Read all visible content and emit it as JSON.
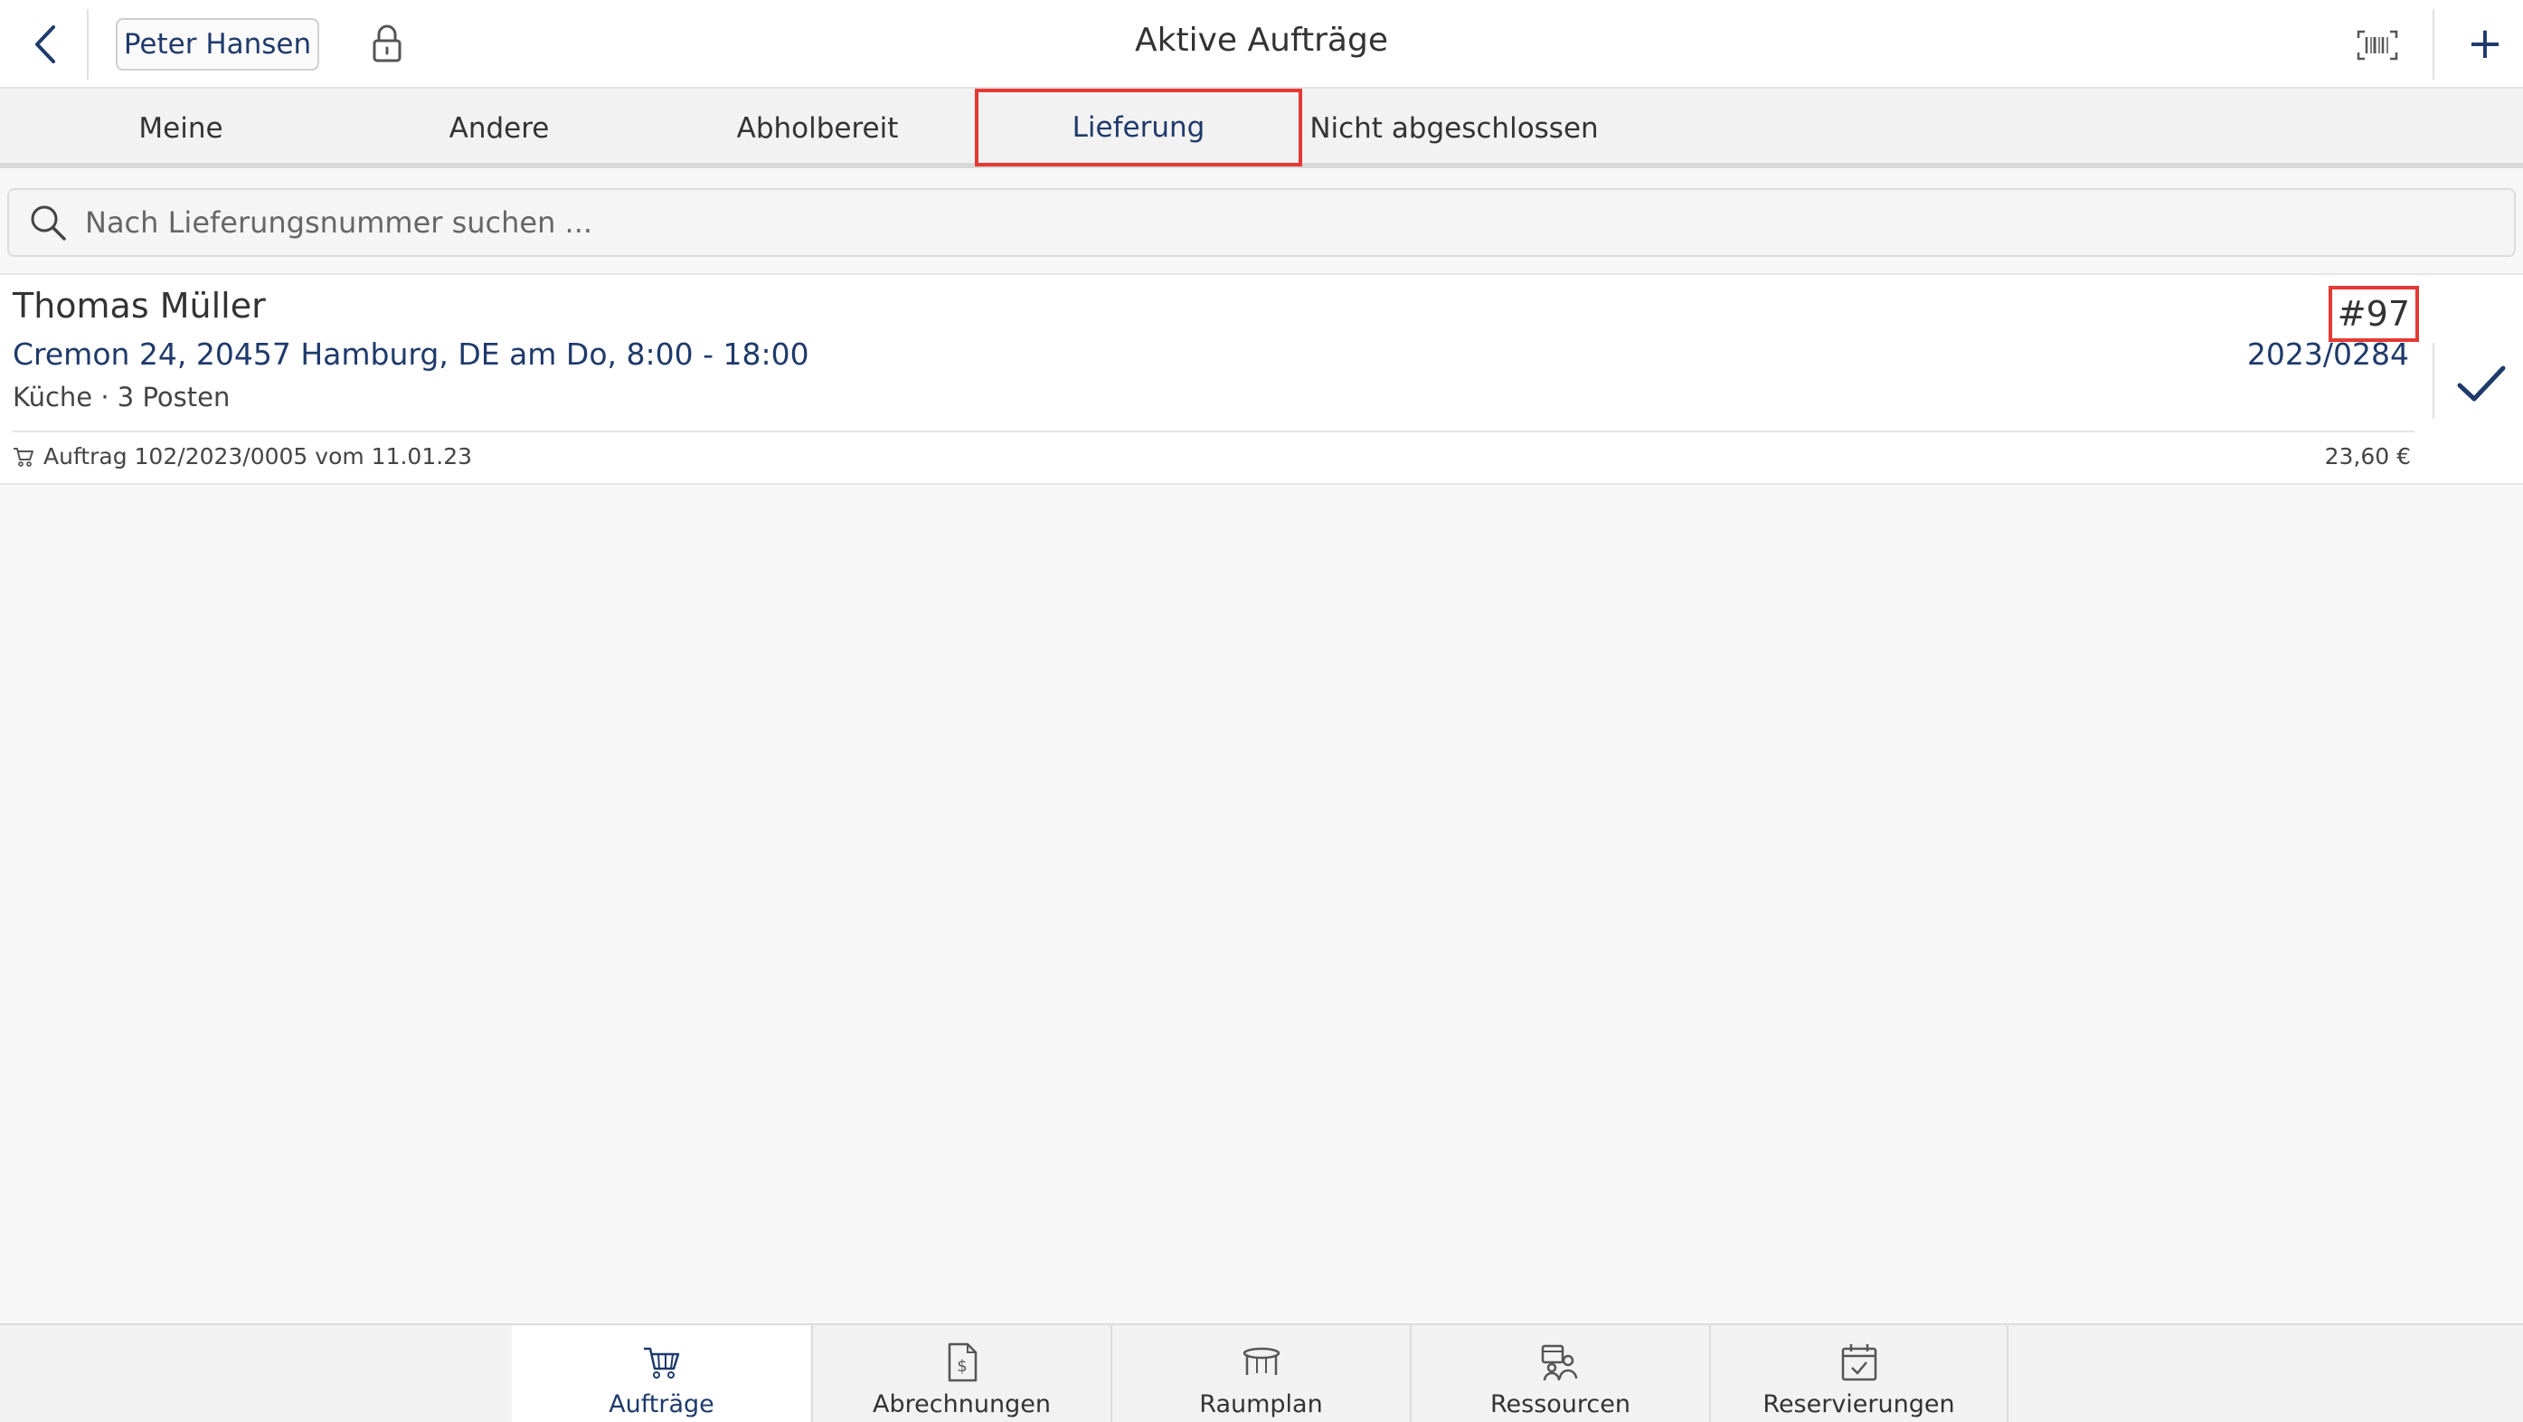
{
  "header": {
    "title": "Aktive Aufträge",
    "user_label": "Peter Hansen",
    "icons": {
      "back": "chevron-left-icon",
      "lock": "lock-icon",
      "barcode": "barcode-scanner-icon",
      "add": "plus-icon"
    },
    "add_glyph": "+"
  },
  "tabs": [
    {
      "label": "Meine",
      "active": false
    },
    {
      "label": "Andere",
      "active": false
    },
    {
      "label": "Abholbereit",
      "active": false
    },
    {
      "label": "Lieferung",
      "active": true
    },
    {
      "label": "Nicht abgeschlossen",
      "active": false
    }
  ],
  "search": {
    "placeholder": "Nach Lieferungsnummer suchen ..."
  },
  "orders": [
    {
      "customer": "Thomas Müller",
      "address": "Cremon 24, 20457 Hamburg, DE am Do, 8:00 - 18:00",
      "meta": "Küche · 3 Posten",
      "tag": "#97",
      "number": "2023/0284",
      "footer": "Auftrag 102/2023/0005 vom 11.01.23",
      "amount": "23,60 €"
    }
  ],
  "bottom_nav": [
    {
      "label": "Aufträge",
      "icon": "cart-icon",
      "active": true
    },
    {
      "label": "Abrechnungen",
      "icon": "invoice-icon",
      "active": false
    },
    {
      "label": "Raumplan",
      "icon": "table-icon",
      "active": false
    },
    {
      "label": "Ressourcen",
      "icon": "resources-icon",
      "active": false
    },
    {
      "label": "Reservierungen",
      "icon": "calendar-check-icon",
      "active": false
    }
  ],
  "colors": {
    "accent": "#1f3a6b",
    "highlight": "#e53935",
    "background": "#f7f7f7"
  }
}
